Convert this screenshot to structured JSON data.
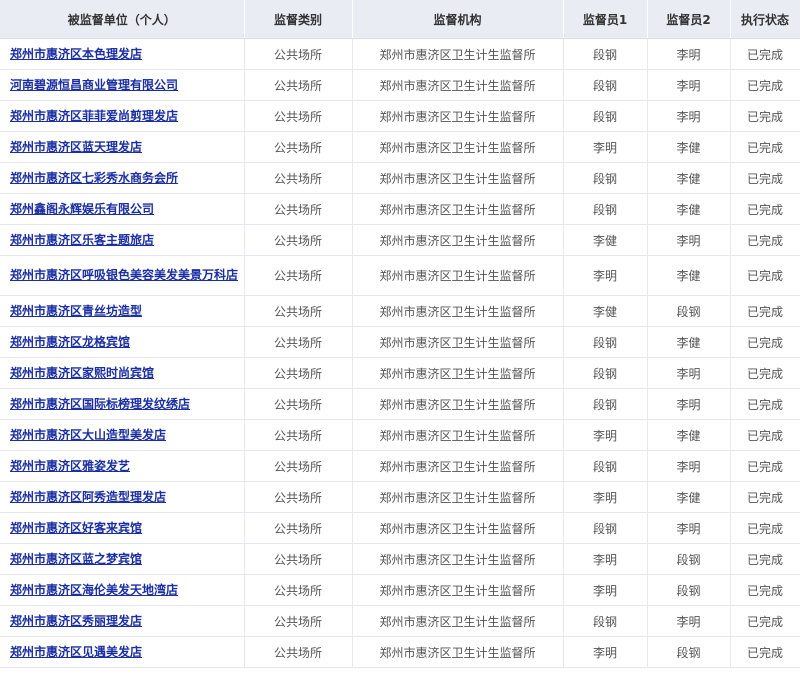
{
  "colors": {
    "header_bg": "#e9ecf3",
    "link": "#1b2fa3",
    "text": "#555555"
  },
  "table": {
    "headers": [
      "被监督单位（个人）",
      "监督类别",
      "监督机构",
      "监督员1",
      "监督员2",
      "执行状态"
    ],
    "rows": [
      {
        "unit": "郑州市惠济区本色理发店",
        "category": "公共场所",
        "agency": "郑州市惠济区卫生计生监督所",
        "inspector1": "段钢",
        "inspector2": "李明",
        "status": "已完成"
      },
      {
        "unit": "河南碧源恒昌商业管理有限公司",
        "category": "公共场所",
        "agency": "郑州市惠济区卫生计生监督所",
        "inspector1": "段钢",
        "inspector2": "李明",
        "status": "已完成"
      },
      {
        "unit": "郑州市惠济区菲菲爱尚剪理发店",
        "category": "公共场所",
        "agency": "郑州市惠济区卫生计生监督所",
        "inspector1": "段钢",
        "inspector2": "李明",
        "status": "已完成"
      },
      {
        "unit": "郑州市惠济区蓝天理发店",
        "category": "公共场所",
        "agency": "郑州市惠济区卫生计生监督所",
        "inspector1": "李明",
        "inspector2": "李健",
        "status": "已完成"
      },
      {
        "unit": "郑州市惠济区七彩秀水商务会所",
        "category": "公共场所",
        "agency": "郑州市惠济区卫生计生监督所",
        "inspector1": "段钢",
        "inspector2": "李健",
        "status": "已完成"
      },
      {
        "unit": "郑州鑫阁永辉娱乐有限公司",
        "category": "公共场所",
        "agency": "郑州市惠济区卫生计生监督所",
        "inspector1": "段钢",
        "inspector2": "李健",
        "status": "已完成"
      },
      {
        "unit": "郑州市惠济区乐客主题旅店",
        "category": "公共场所",
        "agency": "郑州市惠济区卫生计生监督所",
        "inspector1": "李健",
        "inspector2": "李明",
        "status": "已完成"
      },
      {
        "unit": "郑州市惠济区呼吸银色美容美发美景万科店",
        "category": "公共场所",
        "agency": "郑州市惠济区卫生计生监督所",
        "inspector1": "李明",
        "inspector2": "李健",
        "status": "已完成",
        "tall": true
      },
      {
        "unit": "郑州市惠济区青丝坊造型",
        "category": "公共场所",
        "agency": "郑州市惠济区卫生计生监督所",
        "inspector1": "李健",
        "inspector2": "段钢",
        "status": "已完成"
      },
      {
        "unit": "郑州市惠济区龙格宾馆",
        "category": "公共场所",
        "agency": "郑州市惠济区卫生计生监督所",
        "inspector1": "段钢",
        "inspector2": "李健",
        "status": "已完成"
      },
      {
        "unit": "郑州市惠济区家熙时尚宾馆",
        "category": "公共场所",
        "agency": "郑州市惠济区卫生计生监督所",
        "inspector1": "段钢",
        "inspector2": "李明",
        "status": "已完成"
      },
      {
        "unit": "郑州市惠济区国际标榜理发纹绣店",
        "category": "公共场所",
        "agency": "郑州市惠济区卫生计生监督所",
        "inspector1": "段钢",
        "inspector2": "李明",
        "status": "已完成"
      },
      {
        "unit": "郑州市惠济区大山造型美发店",
        "category": "公共场所",
        "agency": "郑州市惠济区卫生计生监督所",
        "inspector1": "李明",
        "inspector2": "李健",
        "status": "已完成"
      },
      {
        "unit": "郑州市惠济区雅姿发艺",
        "category": "公共场所",
        "agency": "郑州市惠济区卫生计生监督所",
        "inspector1": "段钢",
        "inspector2": "李明",
        "status": "已完成"
      },
      {
        "unit": "郑州市惠济区阿秀造型理发店",
        "category": "公共场所",
        "agency": "郑州市惠济区卫生计生监督所",
        "inspector1": "李明",
        "inspector2": "李健",
        "status": "已完成"
      },
      {
        "unit": "郑州市惠济区好客来宾馆",
        "category": "公共场所",
        "agency": "郑州市惠济区卫生计生监督所",
        "inspector1": "段钢",
        "inspector2": "李明",
        "status": "已完成"
      },
      {
        "unit": "郑州市惠济区蓝之梦宾馆",
        "category": "公共场所",
        "agency": "郑州市惠济区卫生计生监督所",
        "inspector1": "李明",
        "inspector2": "段钢",
        "status": "已完成"
      },
      {
        "unit": "郑州市惠济区海伦美发天地湾店",
        "category": "公共场所",
        "agency": "郑州市惠济区卫生计生监督所",
        "inspector1": "李明",
        "inspector2": "段钢",
        "status": "已完成"
      },
      {
        "unit": "郑州市惠济区秀丽理发店",
        "category": "公共场所",
        "agency": "郑州市惠济区卫生计生监督所",
        "inspector1": "段钢",
        "inspector2": "李明",
        "status": "已完成"
      },
      {
        "unit": "郑州市惠济区见遇美发店",
        "category": "公共场所",
        "agency": "郑州市惠济区卫生计生监督所",
        "inspector1": "李明",
        "inspector2": "段钢",
        "status": "已完成"
      }
    ]
  }
}
